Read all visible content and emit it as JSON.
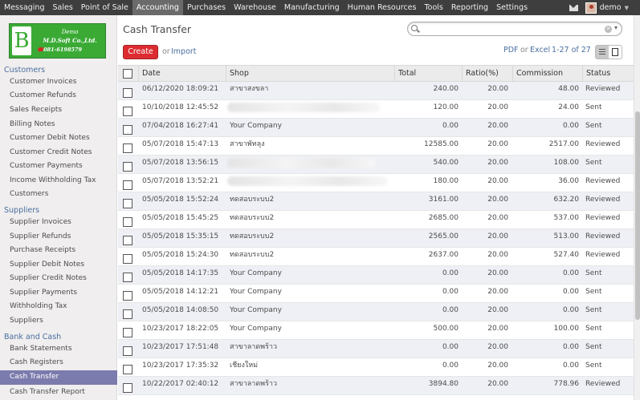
{
  "topbar": {
    "menu": [
      "Messaging",
      "Sales",
      "Point of Sale",
      "Accounting",
      "Purchases",
      "Warehouse",
      "Manufacturing",
      "Human Resources",
      "Tools",
      "Reporting",
      "Settings"
    ],
    "active": "Accounting",
    "user": "demo"
  },
  "logo": {
    "letter": "B",
    "line1": "Demo",
    "line2": "M.D.Soft Co.,Ltd.",
    "line3_prefix": "☎",
    "line3": "081-6198579"
  },
  "sidebar": {
    "customers_head": "Customers",
    "customers": [
      "Customer Invoices",
      "Customer Refunds",
      "Sales Receipts",
      "Billing Notes",
      "Customer Debit Notes",
      "Customer Credit Notes",
      "Customer Payments",
      "Income Withholding Tax",
      "Customers"
    ],
    "suppliers_head": "Suppliers",
    "suppliers": [
      "Supplier Invoices",
      "Supplier Refunds",
      "Purchase Receipts",
      "Supplier Debit Notes",
      "Supplier Credit Notes",
      "Supplier Payments",
      "Withholding Tax",
      "Suppliers"
    ],
    "bank_head": "Bank and Cash",
    "bank": [
      "Bank Statements",
      "Cash Registers",
      "Cash Transfer",
      "Cash Transfer Report"
    ],
    "active": "Cash Transfer"
  },
  "main": {
    "title": "Cash Transfer",
    "search_placeholder": "",
    "create_label": "Create",
    "or": "or",
    "import_label": "Import",
    "pdf_label": "PDF",
    "excel_label": "Excel",
    "pager": "1-27 of 27"
  },
  "table": {
    "headers": [
      "Date",
      "Shop",
      "Total",
      "Ratio(%)",
      "Commission",
      "Status"
    ],
    "rows": [
      {
        "date": "06/12/2020 18:09:21",
        "shop": "สาขาสงขลา",
        "total": "240.00",
        "ratio": "20.00",
        "commission": "48.00",
        "status": "Reviewed"
      },
      {
        "date": "10/10/2018 12:45:52",
        "shop": "",
        "total": "120.00",
        "ratio": "20.00",
        "commission": "24.00",
        "status": "Sent"
      },
      {
        "date": "07/04/2018 16:27:41",
        "shop": "Your Company",
        "total": "0.00",
        "ratio": "20.00",
        "commission": "0.00",
        "status": "Sent"
      },
      {
        "date": "05/07/2018 15:47:13",
        "shop": "สาขาพัทลุง",
        "total": "12585.00",
        "ratio": "20.00",
        "commission": "2517.00",
        "status": "Reviewed"
      },
      {
        "date": "05/07/2018 13:56:15",
        "shop": "",
        "total": "540.00",
        "ratio": "20.00",
        "commission": "108.00",
        "status": "Sent"
      },
      {
        "date": "05/07/2018 13:52:21",
        "shop": "",
        "total": "180.00",
        "ratio": "20.00",
        "commission": "36.00",
        "status": "Reviewed"
      },
      {
        "date": "05/05/2018 15:52:24",
        "shop": "ทดสอบระบบ2",
        "total": "3161.00",
        "ratio": "20.00",
        "commission": "632.20",
        "status": "Reviewed"
      },
      {
        "date": "05/05/2018 15:45:25",
        "shop": "ทดสอบระบบ2",
        "total": "2685.00",
        "ratio": "20.00",
        "commission": "537.00",
        "status": "Reviewed"
      },
      {
        "date": "05/05/2018 15:35:15",
        "shop": "ทดสอบระบบ2",
        "total": "2565.00",
        "ratio": "20.00",
        "commission": "513.00",
        "status": "Reviewed"
      },
      {
        "date": "05/05/2018 15:24:30",
        "shop": "ทดสอบระบบ2",
        "total": "2637.00",
        "ratio": "20.00",
        "commission": "527.40",
        "status": "Reviewed"
      },
      {
        "date": "05/05/2018 14:17:35",
        "shop": "Your Company",
        "total": "0.00",
        "ratio": "20.00",
        "commission": "0.00",
        "status": "Sent"
      },
      {
        "date": "05/05/2018 14:12:21",
        "shop": "Your Company",
        "total": "0.00",
        "ratio": "20.00",
        "commission": "0.00",
        "status": "Sent"
      },
      {
        "date": "05/05/2018 14:08:50",
        "shop": "Your Company",
        "total": "0.00",
        "ratio": "20.00",
        "commission": "0.00",
        "status": "Sent"
      },
      {
        "date": "10/23/2017 18:22:05",
        "shop": "Your Company",
        "total": "500.00",
        "ratio": "20.00",
        "commission": "100.00",
        "status": "Sent"
      },
      {
        "date": "10/23/2017 17:51:48",
        "shop": "สาขาลาดพร้าว",
        "total": "0.00",
        "ratio": "20.00",
        "commission": "0.00",
        "status": "Sent"
      },
      {
        "date": "10/23/2017 17:35:32",
        "shop": "เชียงใหม่",
        "total": "0.00",
        "ratio": "20.00",
        "commission": "0.00",
        "status": "Sent"
      },
      {
        "date": "10/22/2017 02:40:12",
        "shop": "สาขาลาดพร้าว",
        "total": "3894.80",
        "ratio": "20.00",
        "commission": "778.96",
        "status": "Reviewed"
      }
    ]
  }
}
